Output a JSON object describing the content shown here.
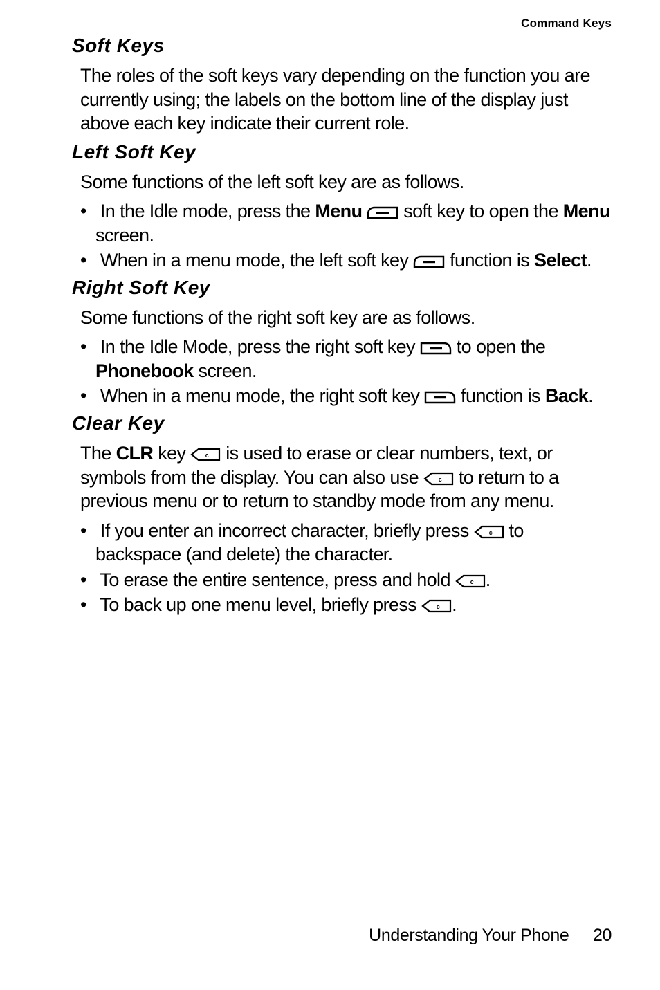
{
  "header": {
    "section_label": "Command Keys"
  },
  "soft_keys": {
    "heading": "Soft Keys",
    "para": "The roles of the soft keys vary depending on the function you are currently using; the labels on the bottom line of the display just above each key indicate their current role."
  },
  "left_soft_key": {
    "heading": "Left Soft Key",
    "intro": "Some functions of the left soft key are as follows.",
    "b1_pre": "In the Idle mode, press the ",
    "b1_menu": "Menu",
    "b1_mid": " soft key to open the ",
    "b1_menu2": "Menu",
    "b1_post": " screen.",
    "b2_pre": "When in a menu mode, the left soft key ",
    "b2_mid": " function is ",
    "b2_select": "Select",
    "b2_post": "."
  },
  "right_soft_key": {
    "heading": "Right Soft Key",
    "intro": "Some functions of the right soft key are as follows.",
    "b1_pre": "In the Idle Mode, press the right soft key ",
    "b1_mid": " to open the ",
    "b1_phonebook": "Phonebook",
    "b1_post": " screen.",
    "b2_pre": "When in a menu mode, the right soft key ",
    "b2_mid": " function is ",
    "b2_back": "Back",
    "b2_post": "."
  },
  "clear_key": {
    "heading": "Clear Key",
    "p_pre": "The ",
    "p_clr": "CLR",
    "p_mid1": " key ",
    "p_mid2": " is used to erase or clear numbers, text, or symbols from the display. You can also use ",
    "p_post": " to return to a previous menu or to return to standby mode from any menu.",
    "b1_pre": "If you enter an incorrect character, briefly press ",
    "b1_post": " to backspace (and delete) the character.",
    "b2_pre": "To erase the entire sentence, press and hold ",
    "b2_post": ".",
    "b3_pre": "To back up one menu level, briefly press ",
    "b3_post": "."
  },
  "footer": {
    "chapter": "Understanding Your Phone",
    "page": "20"
  }
}
